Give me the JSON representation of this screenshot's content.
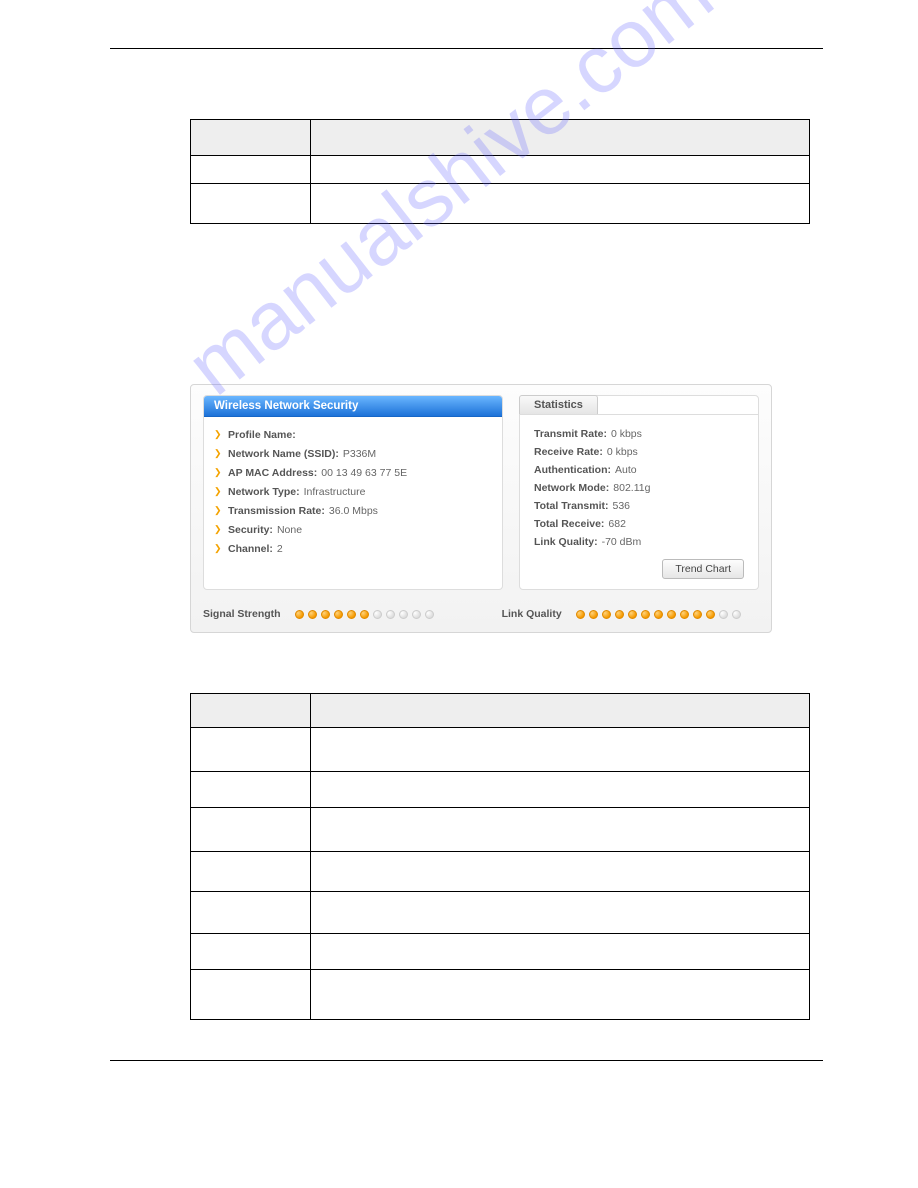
{
  "watermark": "manualshive.com",
  "panel": {
    "left_title": "Wireless Network Security",
    "items": [
      {
        "label": "Profile Name:",
        "value": ""
      },
      {
        "label": "Network Name (SSID):",
        "value": "P336M"
      },
      {
        "label": "AP MAC Address:",
        "value": "00 13 49 63 77 5E"
      },
      {
        "label": "Network Type:",
        "value": "Infrastructure"
      },
      {
        "label": "Transmission Rate:",
        "value": "36.0 Mbps"
      },
      {
        "label": "Security:",
        "value": "None"
      },
      {
        "label": "Channel:",
        "value": "2"
      }
    ],
    "stats_tab": "Statistics",
    "stats": [
      {
        "label": "Transmit Rate:",
        "value": "0 kbps"
      },
      {
        "label": "Receive Rate:",
        "value": "0 kbps"
      },
      {
        "label": "Authentication:",
        "value": "Auto"
      },
      {
        "label": "Network Mode:",
        "value": "802.11g"
      },
      {
        "label": "Total Transmit:",
        "value": "536"
      },
      {
        "label": "Total Receive:",
        "value": "682"
      },
      {
        "label": "Link Quality:",
        "value": "-70 dBm"
      }
    ],
    "trend_button": "Trend Chart",
    "signal_strength_label": "Signal Strength",
    "link_quality_label": "Link Quality",
    "signal_dots_on": 6,
    "signal_dots_total": 11,
    "lq_dots_on": 11,
    "lq_dots_total": 13
  }
}
